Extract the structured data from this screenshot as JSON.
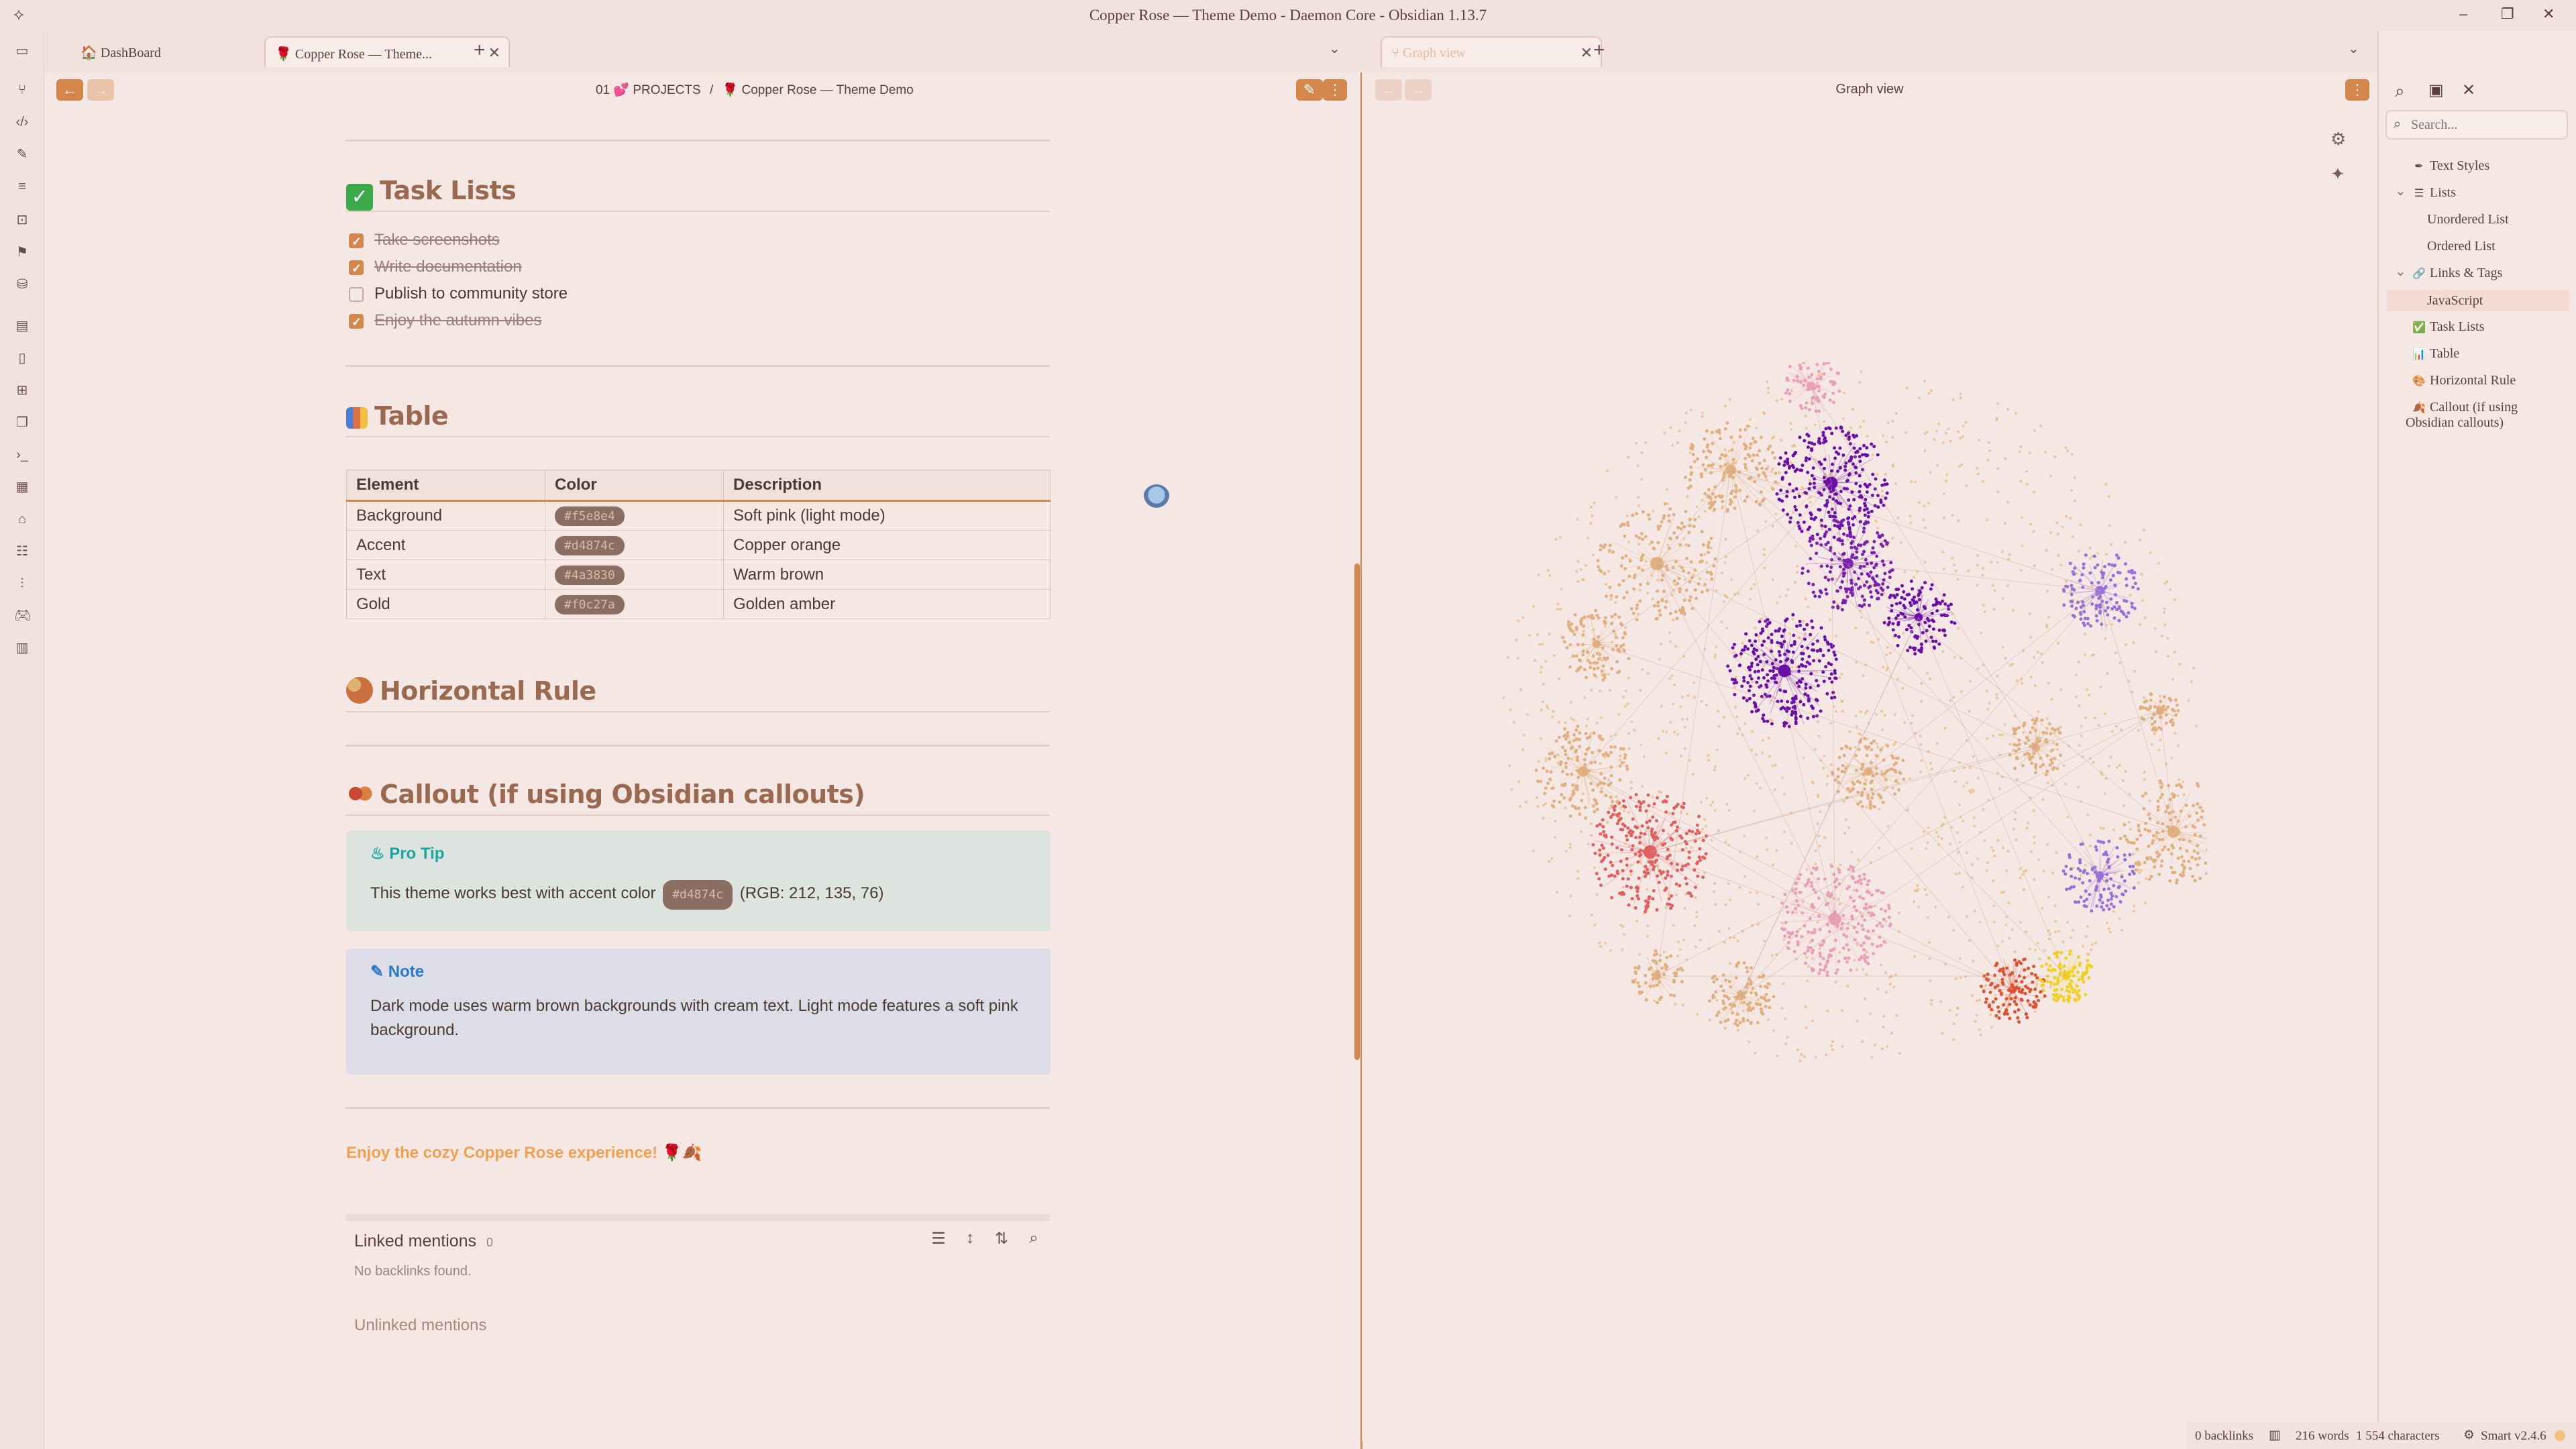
{
  "window": {
    "title": "Copper Rose — Theme Demo - Daemon Core - Obsidian 1.13.7"
  },
  "tabs_left": [
    {
      "label": "DashBoard",
      "icon": "dashboard-icon"
    },
    {
      "label": "Copper Rose — Theme...",
      "icon": "rose-icon",
      "active": true
    }
  ],
  "tabs_right": [
    {
      "label": "Graph view",
      "icon": "graph-icon",
      "active": true
    }
  ],
  "breadcrumb": {
    "folder": "01 💕 PROJECTS",
    "separator": "/",
    "note": "🌹 Copper Rose — Theme Demo"
  },
  "graph_header": {
    "title": "Graph view"
  },
  "sections": {
    "tasks": {
      "heading": "Task Lists",
      "items": [
        {
          "label": "Take screenshots",
          "done": true
        },
        {
          "label": "Write documentation",
          "done": true
        },
        {
          "label": "Publish to community store",
          "done": false
        },
        {
          "label": "Enjoy the autumn vibes",
          "done": true
        }
      ]
    },
    "table": {
      "heading": "Table",
      "headers": [
        "Element",
        "Color",
        "Description"
      ],
      "rows": [
        [
          "Background",
          "#f5e8e4",
          "Soft pink (light mode)"
        ],
        [
          "Accent",
          "#d4874c",
          "Copper orange"
        ],
        [
          "Text",
          "#4a3830",
          "Warm brown"
        ],
        [
          "Gold",
          "#f0c27a",
          "Golden amber"
        ]
      ]
    },
    "hr": {
      "heading": "Horizontal Rule"
    },
    "callout": {
      "heading": "Callout (if using Obsidian callouts)"
    }
  },
  "callouts": {
    "tip": {
      "title": "Pro Tip",
      "text_before": "This theme works best with accent color",
      "code": "#d4874c",
      "text_after": "(RGB: 212, 135, 76)"
    },
    "note": {
      "title": "Note",
      "text": "Dark mode uses warm brown backgrounds with cream text. Light mode features a soft pink background."
    }
  },
  "footer_line": "Enjoy the cozy Copper Rose experience! 🌹🍂",
  "backlinks": {
    "linked_title": "Linked mentions",
    "linked_count": "0",
    "empty": "No backlinks found.",
    "unlinked_title": "Unlinked mentions"
  },
  "sidebar": {
    "search_placeholder": "Search...",
    "outline": [
      {
        "label": "Text Styles",
        "icon": "✒",
        "indent": 1
      },
      {
        "label": "Lists",
        "icon": "☰",
        "indent": 1,
        "collapsible": true
      },
      {
        "label": "Unordered List",
        "indent": 2
      },
      {
        "label": "Ordered List",
        "indent": 2
      },
      {
        "label": "Links & Tags",
        "icon": "🔗",
        "indent": 1,
        "collapsible": true
      },
      {
        "label": "JavaScript",
        "indent": 2,
        "selected": true
      },
      {
        "label": "Task Lists",
        "icon": "✅",
        "indent": 1
      },
      {
        "label": "Table",
        "icon": "📊",
        "indent": 1
      },
      {
        "label": "Horizontal Rule",
        "icon": "🎨",
        "indent": 1
      },
      {
        "label": "Callout (if using",
        "label2": "Obsidian callouts)",
        "icon": "🍂",
        "indent": 1
      }
    ]
  },
  "statusbar": {
    "backlinks": "0 backlinks",
    "words": "216 words",
    "chars": "1 554 characters",
    "plugin": "Smart v2.4.6"
  },
  "colors": {
    "accent": "#d4874c",
    "background": "#f5e8e4",
    "text": "#4a3830",
    "gold": "#f0c27a",
    "tip_bg": "#dde3df",
    "note_bg": "#dcdde6"
  }
}
